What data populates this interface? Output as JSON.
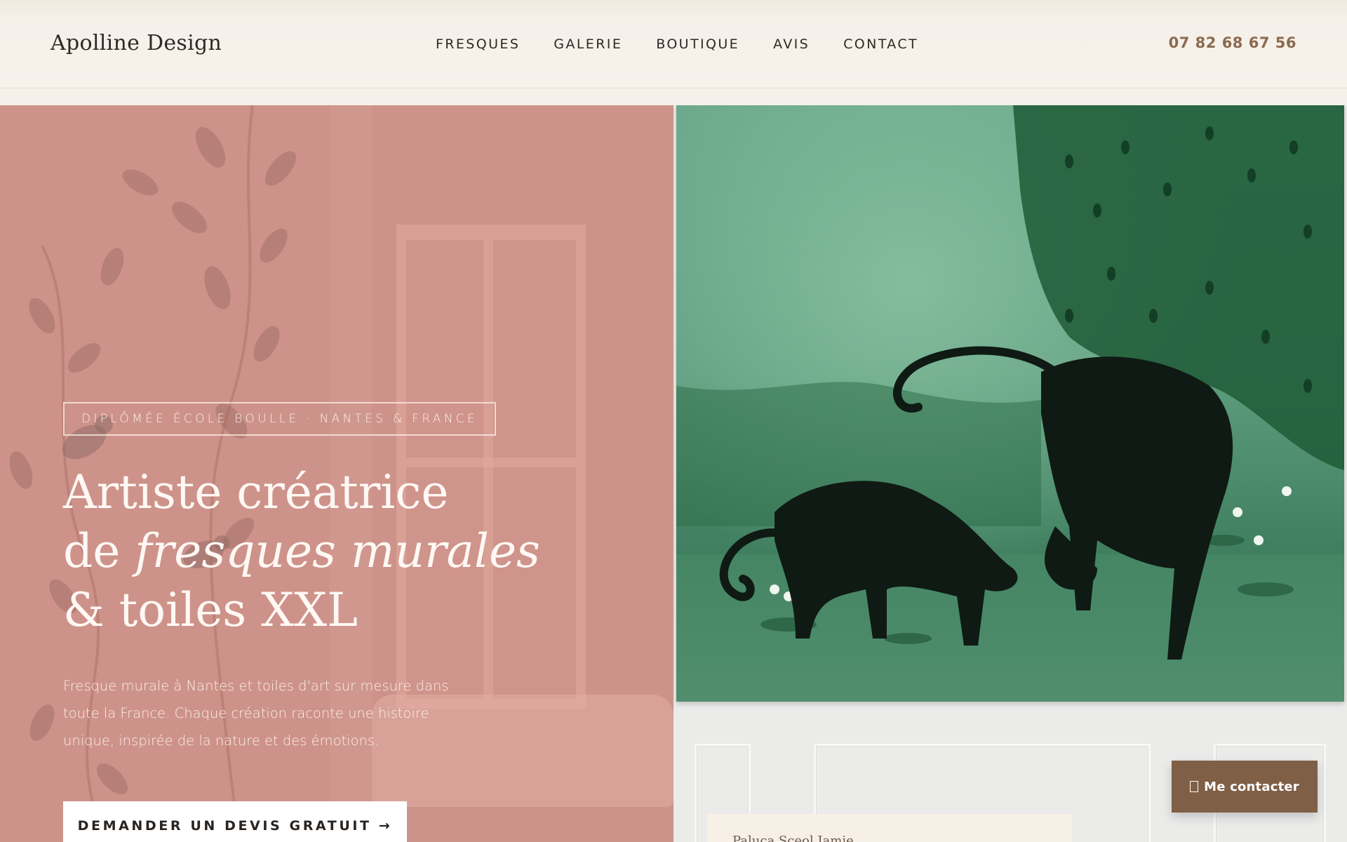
{
  "header": {
    "logo": "Apolline Design",
    "nav": [
      "FRESQUES",
      "GALERIE",
      "BOUTIQUE",
      "AVIS",
      "CONTACT"
    ],
    "phone": "07 82 68 67 56"
  },
  "hero": {
    "badge": "DIPLÔMÉE ÉCOLE BOULLE · NANTES & FRANCE",
    "headline": {
      "line1": "Artiste créatrice",
      "line2_prefix": "de ",
      "line2_italic": "fresques murales",
      "line3": "& toiles XXL"
    },
    "lead": "Fresque murale à Nantes et toiles d'art sur mesure dans toute la France. Chaque création raconte une histoire unique, inspirée de la nature et des émotions.",
    "cta_label": "DEMANDER UN DEVIS GRATUIT →",
    "caption": "Paluca Sceol Jamie"
  },
  "floating": {
    "contact_label": "Me contacter"
  },
  "colors": {
    "hero_left_bg": "#cd938a",
    "accent_brown": "#7f5f46",
    "phone_color": "#8c6a4f"
  }
}
